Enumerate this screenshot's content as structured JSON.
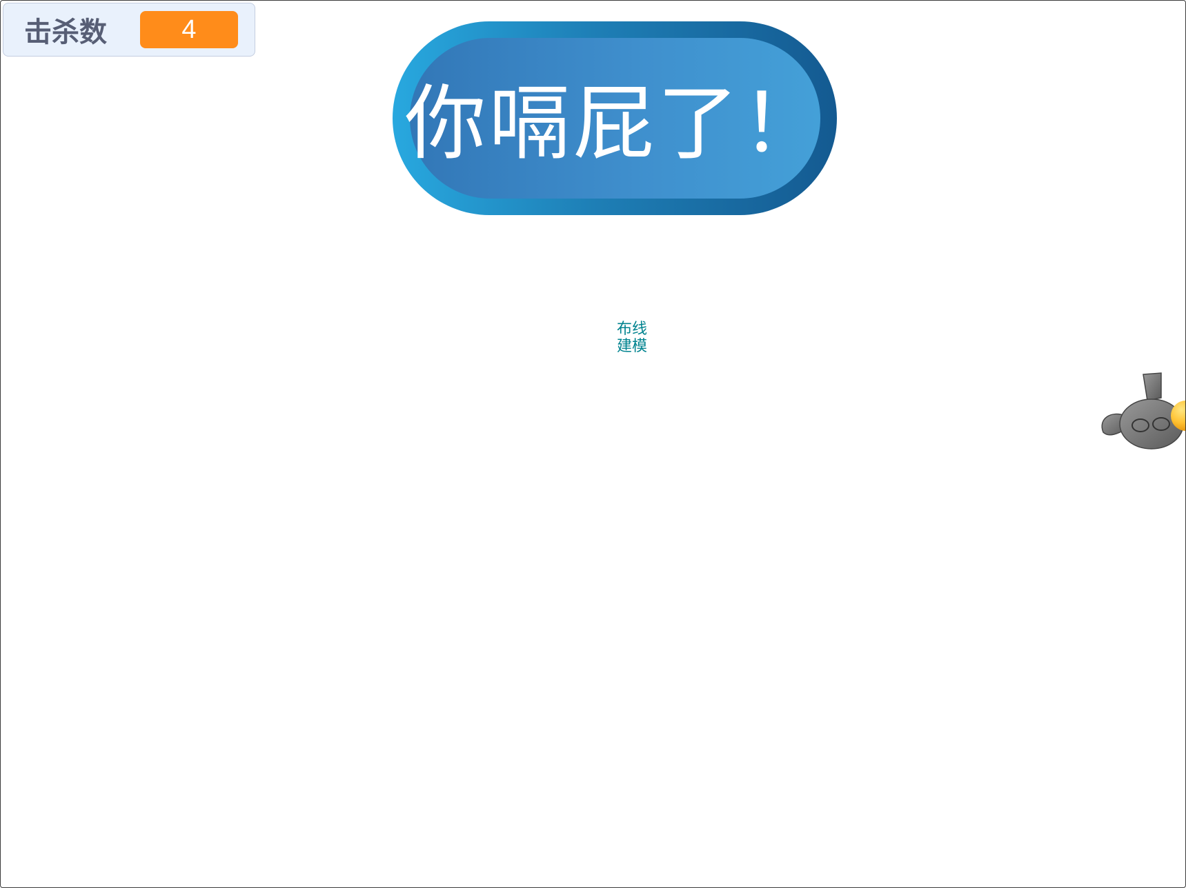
{
  "monitor": {
    "label": "击杀数",
    "value": "4"
  },
  "banner": {
    "text": "你嗝屁了！"
  },
  "center_label": {
    "line1": "布线",
    "line2": "建模"
  },
  "colors": {
    "monitor_value_bg": "#ff8c1a",
    "banner_outer_left": "#28a8df",
    "banner_outer_right": "#145a91",
    "banner_inner": "#3f8fcd",
    "label_teal": "#00838f"
  },
  "sprite": {
    "icon": "gray-bunny-sprite-icon"
  }
}
